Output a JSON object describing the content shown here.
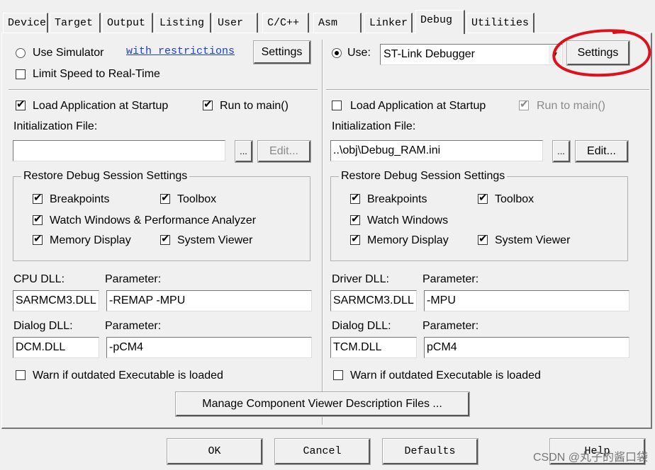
{
  "tabs": [
    {
      "label": "Device",
      "active": false
    },
    {
      "label": "Target",
      "active": false
    },
    {
      "label": "Output",
      "active": false
    },
    {
      "label": "Listing",
      "active": false
    },
    {
      "label": "User",
      "active": false
    },
    {
      "label": "C/C++",
      "active": false
    },
    {
      "label": "Asm",
      "active": false
    },
    {
      "label": "Linker",
      "active": false
    },
    {
      "label": "Debug",
      "active": true
    },
    {
      "label": "Utilities",
      "active": false
    }
  ],
  "left": {
    "use_simulator": {
      "label": "Use Simulator",
      "checked": false
    },
    "restrictions_link": "with restrictions",
    "settings_label": "Settings",
    "limit_speed": {
      "label": "Limit Speed to Real-Time",
      "checked": false
    },
    "load_app": {
      "label": "Load Application at Startup",
      "checked": true
    },
    "run_main": {
      "label": "Run to main()",
      "checked": true
    },
    "init_file_label": "Initialization File:",
    "init_file_value": "",
    "browse_label": "...",
    "edit_label": "Edit...",
    "restore_title": "Restore Debug Session Settings",
    "breakpoints": {
      "label": "Breakpoints",
      "checked": true
    },
    "toolbox": {
      "label": "Toolbox",
      "checked": true
    },
    "watch": {
      "label": "Watch Windows & Performance Analyzer",
      "checked": true
    },
    "memory": {
      "label": "Memory Display",
      "checked": true
    },
    "sysviewer": {
      "label": "System Viewer",
      "checked": true
    },
    "cpu_dll_label": "CPU DLL:",
    "cpu_param_label": "Parameter:",
    "cpu_dll_value": "SARMCM3.DLL",
    "cpu_param_value": "-REMAP -MPU",
    "dialog_dll_label": "Dialog DLL:",
    "dialog_param_label": "Parameter:",
    "dialog_dll_value": "DCM.DLL",
    "dialog_param_value": "-pCM4",
    "warn": {
      "label": "Warn if outdated Executable is loaded",
      "checked": false
    }
  },
  "right": {
    "use": {
      "label": "Use:",
      "checked": true
    },
    "debugger_value": "ST-Link Debugger",
    "settings_label": "Settings",
    "load_app": {
      "label": "Load Application at Startup",
      "checked": false
    },
    "run_main": {
      "label": "Run to main()",
      "checked": true,
      "disabled": true
    },
    "init_file_label": "Initialization File:",
    "init_file_value": "..\\obj\\Debug_RAM.ini",
    "browse_label": "...",
    "edit_label": "Edit...",
    "restore_title": "Restore Debug Session Settings",
    "breakpoints": {
      "label": "Breakpoints",
      "checked": true
    },
    "toolbox": {
      "label": "Toolbox",
      "checked": true
    },
    "watch": {
      "label": "Watch Windows",
      "checked": true
    },
    "memory": {
      "label": "Memory Display",
      "checked": true
    },
    "sysviewer": {
      "label": "System Viewer",
      "checked": true
    },
    "driver_dll_label": "Driver DLL:",
    "driver_param_label": "Parameter:",
    "driver_dll_value": "SARMCM3.DLL",
    "driver_param_value": "-MPU",
    "dialog_dll_label": "Dialog DLL:",
    "dialog_param_label": "Parameter:",
    "dialog_dll_value": "TCM.DLL",
    "dialog_param_value": "pCM4",
    "warn": {
      "label": "Warn if outdated Executable is loaded",
      "checked": false
    }
  },
  "manage_label": "Manage Component Viewer Description Files ...",
  "footer": {
    "ok": "OK",
    "cancel": "Cancel",
    "defaults": "Defaults",
    "help": "Help"
  },
  "watermark": "CSDN @丸子的酱口袋",
  "annotation_color": "#e0101a"
}
